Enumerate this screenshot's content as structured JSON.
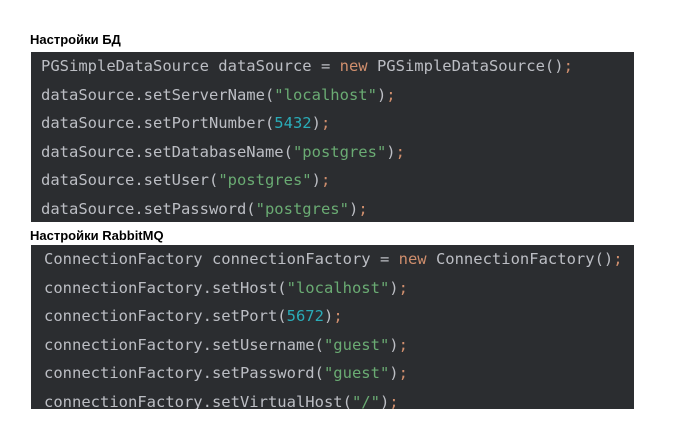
{
  "sections": [
    {
      "title": "Настройки БД",
      "lines": [
        [
          [
            "t",
            "PGSimpleDataSource dataSource = "
          ],
          [
            "k",
            "new"
          ],
          [
            "t",
            " PGSimpleDataSource()"
          ],
          [
            "s",
            ";"
          ]
        ],
        [
          [
            "t",
            "dataSource.setServerName("
          ],
          [
            "q",
            "\"localhost\""
          ],
          [
            "t",
            ")"
          ],
          [
            "s",
            ";"
          ]
        ],
        [
          [
            "t",
            "dataSource.setPortNumber("
          ],
          [
            "n",
            "5432"
          ],
          [
            "t",
            ")"
          ],
          [
            "s",
            ";"
          ]
        ],
        [
          [
            "t",
            "dataSource.setDatabaseName("
          ],
          [
            "q",
            "\"postgres\""
          ],
          [
            "t",
            ")"
          ],
          [
            "s",
            ";"
          ]
        ],
        [
          [
            "t",
            "dataSource.setUser("
          ],
          [
            "q",
            "\"postgres\""
          ],
          [
            "t",
            ")"
          ],
          [
            "s",
            ";"
          ]
        ],
        [
          [
            "t",
            "dataSource.setPassword("
          ],
          [
            "q",
            "\"postgres\""
          ],
          [
            "t",
            ")"
          ],
          [
            "s",
            ";"
          ]
        ]
      ]
    },
    {
      "title": "Настройки RabbitMQ",
      "lines": [
        [
          [
            "t",
            "ConnectionFactory connectionFactory = "
          ],
          [
            "k",
            "new"
          ],
          [
            "t",
            " ConnectionFactory()"
          ],
          [
            "s",
            ";"
          ]
        ],
        [
          [
            "t",
            "connectionFactory.setHost("
          ],
          [
            "q",
            "\"localhost\""
          ],
          [
            "t",
            ")"
          ],
          [
            "s",
            ";"
          ]
        ],
        [
          [
            "t",
            "connectionFactory.setPort("
          ],
          [
            "n",
            "5672"
          ],
          [
            "t",
            ")"
          ],
          [
            "s",
            ";"
          ]
        ],
        [
          [
            "t",
            "connectionFactory.setUsername("
          ],
          [
            "q",
            "\"guest\""
          ],
          [
            "t",
            ")"
          ],
          [
            "s",
            ";"
          ]
        ],
        [
          [
            "t",
            "connectionFactory.setPassword("
          ],
          [
            "q",
            "\"guest\""
          ],
          [
            "t",
            ")"
          ],
          [
            "s",
            ";"
          ]
        ],
        [
          [
            "t",
            "connectionFactory.setVirtualHost("
          ],
          [
            "q",
            "\"/\""
          ],
          [
            "t",
            ")"
          ],
          [
            "s",
            ";"
          ]
        ]
      ]
    }
  ],
  "colors": {
    "background": "#ffffff",
    "code_background": "#2b2d30",
    "code_text": "#bcbec4",
    "keyword": "#cf8e6d",
    "string": "#6aab73",
    "number": "#2aacb8"
  }
}
